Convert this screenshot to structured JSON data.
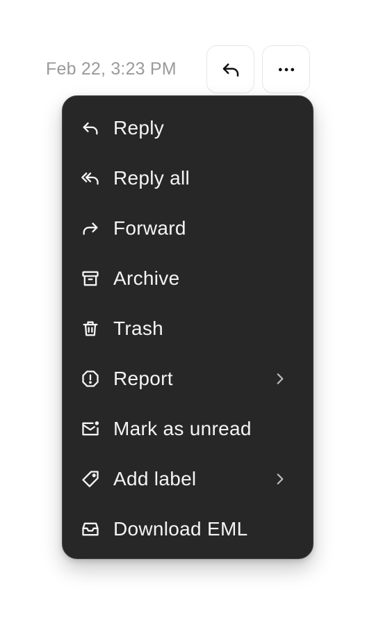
{
  "header": {
    "timestamp": "Feb 22, 3:23 PM",
    "reply_icon": "reply-icon",
    "more_icon": "more-horizontal-icon"
  },
  "menu": {
    "items": [
      {
        "label": "Reply",
        "icon": "reply-icon",
        "has_submenu": false
      },
      {
        "label": "Reply all",
        "icon": "reply-all-icon",
        "has_submenu": false
      },
      {
        "label": "Forward",
        "icon": "forward-icon",
        "has_submenu": false
      },
      {
        "label": "Archive",
        "icon": "archive-icon",
        "has_submenu": false
      },
      {
        "label": "Trash",
        "icon": "trash-icon",
        "has_submenu": false
      },
      {
        "label": "Report",
        "icon": "report-icon",
        "has_submenu": true
      },
      {
        "label": "Mark as unread",
        "icon": "mark-unread-icon",
        "has_submenu": false
      },
      {
        "label": "Add label",
        "icon": "tag-icon",
        "has_submenu": true
      },
      {
        "label": "Download EML",
        "icon": "download-eml-icon",
        "has_submenu": false
      }
    ]
  },
  "colors": {
    "menu_background": "#272727",
    "menu_text": "#f4f4f4",
    "timestamp_text": "#9a9a9a",
    "button_border": "#e6e6e6"
  }
}
